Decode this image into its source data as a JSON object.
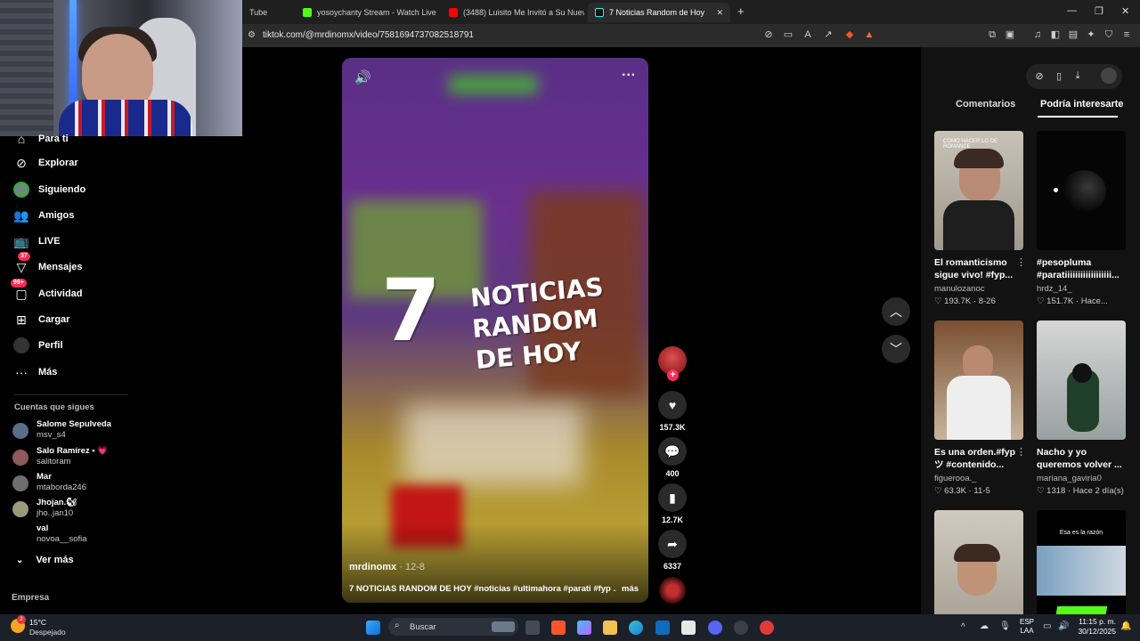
{
  "browser": {
    "tabs": [
      {
        "label": "Tube",
        "active": false
      },
      {
        "label": "yosoychanty Stream - Watch Live on",
        "active": false
      },
      {
        "label": "(3488) Luisito Me Invitó a Su Nuevo",
        "active": false
      },
      {
        "label": "7 Noticias Random de Hoy",
        "active": true
      }
    ],
    "url": "tiktok.com/@mrdinomx/video/7581694737082518791"
  },
  "sidebar": {
    "items": [
      {
        "label": "Para ti",
        "icon": "home-icon"
      },
      {
        "label": "Explorar",
        "icon": "compass-icon"
      },
      {
        "label": "Siguiendo",
        "icon": "following-avatar-icon"
      },
      {
        "label": "Amigos",
        "icon": "friends-icon"
      },
      {
        "label": "LIVE",
        "icon": "live-tv-icon"
      },
      {
        "label": "Mensajes",
        "icon": "messages-icon",
        "badge": "37"
      },
      {
        "label": "Actividad",
        "icon": "activity-icon",
        "badge": "99+"
      },
      {
        "label": "Cargar",
        "icon": "upload-icon"
      },
      {
        "label": "Perfil",
        "icon": "profile-icon"
      },
      {
        "label": "Más",
        "icon": "more-dots-icon"
      }
    ],
    "following_title": "Cuentas que sigues",
    "accounts": [
      {
        "name": "Salome Sepulveda",
        "user": "msv_s4"
      },
      {
        "name": "Salo Ramírez • 💗",
        "user": "salitoram"
      },
      {
        "name": "Mar",
        "user": "mtaborda246"
      },
      {
        "name": "Jhojan.🐿",
        "user": "jho..jan10"
      },
      {
        "name": "val",
        "user": "novoa__sofia"
      }
    ],
    "see_more": "Ver más",
    "footer": "Empresa"
  },
  "video": {
    "overlay_number": "7",
    "overlay_line1": "NOTICIAS",
    "overlay_line2": "RANDOM",
    "overlay_line3": "DE HOY",
    "author": "mrdinomx",
    "date": " · 12-8",
    "caption": "7 NOTICIAS RANDOM DE HOY #noticias #ultimahora #parati #fyp ...",
    "more": "más"
  },
  "actions": {
    "likes": "157.3K",
    "comments": "400",
    "saves": "12.7K",
    "shares": "6337"
  },
  "panel": {
    "tab_comments": "Comentarios",
    "tab_interest": "Podría interesarte",
    "cards": [
      {
        "title": "El romanticismo sigue vivo! #fyp...",
        "user": "manulozanoc",
        "stats": "♡ 193.7K · 8-26",
        "thumb_text": "COMO HACER LO DE ROMANCE"
      },
      {
        "title": "#pesopluma #paratiiiiiiiiiiiiiiiiii...",
        "user": "hrdz_14_",
        "stats": "♡ 151.7K · Hace...",
        "thumb_text": ""
      },
      {
        "title": "Es una orden.#fyp ツ #contenido...",
        "user": "figuerooa._",
        "stats": "♡ 63.3K · 11-5",
        "thumb_text": ""
      },
      {
        "title": "Nacho y yo queremos volver ...",
        "user": "mariana_gaviria0",
        "stats": "♡ 1318 · Hace 2 día(s)",
        "thumb_text": ""
      },
      {
        "title": "",
        "user": "",
        "stats": "",
        "thumb_text": ""
      },
      {
        "title": "",
        "user": "",
        "stats": "",
        "thumb_text": "Esa es la razón"
      }
    ]
  },
  "taskbar": {
    "temp": "15°C",
    "condition": "Despejado",
    "search": "Buscar",
    "lang1": "ESP",
    "lang2": "LAA",
    "time": "11:15 p. m.",
    "date": "30/12/2025"
  },
  "colors": {
    "accent": "#fe2c55",
    "sidebar_bg": "#000000",
    "panel_bg": "#121212",
    "taskbar_bg": "#1c2029"
  }
}
